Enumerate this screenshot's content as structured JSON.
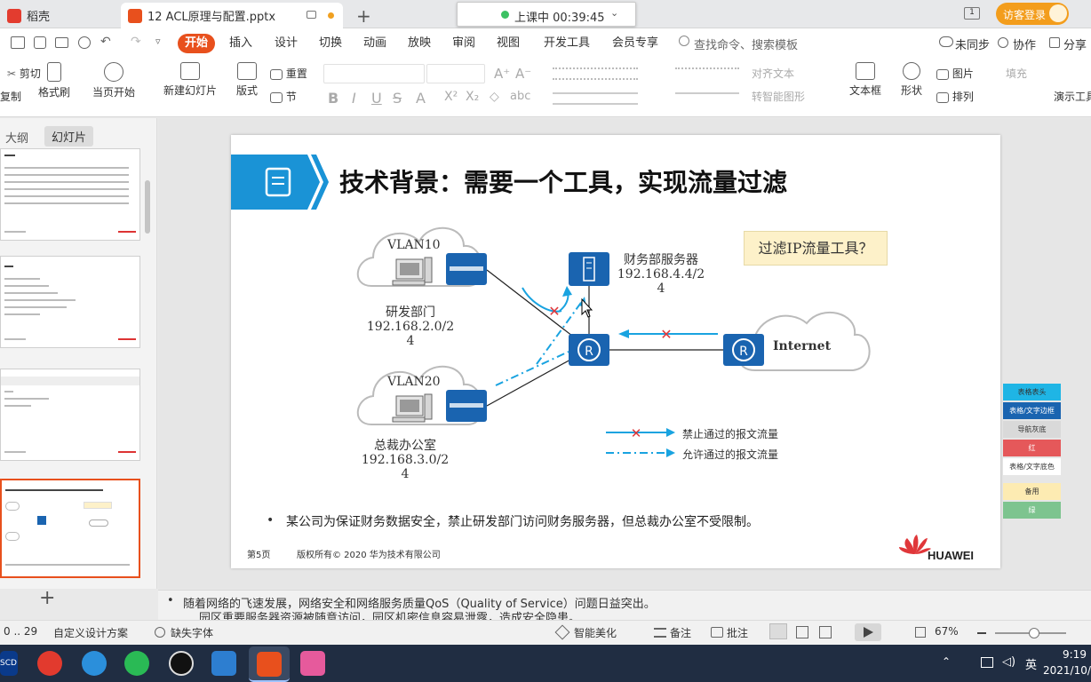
{
  "tabs": {
    "home": "稻壳",
    "file": "12 ACL原理与配置.pptx",
    "new_tab": "+"
  },
  "classroom": {
    "status": "上课中 00:39:45"
  },
  "account": {
    "visitor": "访客登录"
  },
  "ribbon_tabs": [
    "开始",
    "插入",
    "设计",
    "切换",
    "动画",
    "放映",
    "审阅",
    "视图",
    "开发工具",
    "会员专享"
  ],
  "search": {
    "placeholder": "查找命令、搜索模板"
  },
  "top_actions": {
    "sync": "未同步",
    "collab": "协作",
    "share": "分享"
  },
  "toolbar": {
    "cut": "剪切",
    "copy": "复制",
    "format_painter": "格式刷",
    "play_from": "当页开始",
    "new_slide": "新建幻灯片",
    "layout": "版式",
    "reset": "重置",
    "section": "节",
    "text_box": "文本框",
    "shape": "形状",
    "picture": "图片",
    "arrange": "排列",
    "fill": "填充",
    "align_text": "对齐文本",
    "smart_shape": "转智能图形",
    "demo": "演示工具"
  },
  "panel_tabs": {
    "outline": "大纲",
    "slides": "幻灯片"
  },
  "slide": {
    "title": "技术背景：需要一个工具，实现流量过滤",
    "callout": "过滤IP流量工具？",
    "vlan10": "VLAN10",
    "vlan20": "VLAN20",
    "dept_rd": "研发部门",
    "rd_ip": "192.168.2.0/2",
    "rd_ip2": "4",
    "dept_ceo": "总裁办公室",
    "ceo_ip": "192.168.3.0/2",
    "ceo_ip2": "4",
    "server_name": "财务部服务器",
    "server_ip": "192.168.4.4/2",
    "server_ip2": "4",
    "internet": "Internet",
    "legend_deny": "禁止通过的报文流量",
    "legend_allow": "允许通过的报文流量",
    "bullet": "某公司为保证财务数据安全，禁止研发部门访问财务服务器，但总裁办公室不受限制。",
    "page": "第5页",
    "copyright": "版权所有© 2020 华为技术有限公司",
    "brand": "HUAWEI"
  },
  "color_legend": [
    "表格表头",
    "表格/文字边框",
    "导航灰底",
    "红",
    "表格/文字底色",
    "备用",
    "绿"
  ],
  "notes": {
    "line1": "随着网络的飞速发展，网络安全和网络服务质量QoS（Quality of Service）问题日益突出。",
    "line2": "园区重要服务器资源被随意访问，园区机密信息容易泄露，造成安全隐患。"
  },
  "status": {
    "pages": "0 .. 29",
    "design": "自定义设计方案",
    "font": "缺失字体",
    "beautify": "智能美化",
    "notes": "备注",
    "comment": "批注",
    "zoom": "67%"
  },
  "taskbar": {
    "time": "9:19",
    "date": "2021/10/",
    "ime": "英"
  },
  "colors": {
    "accent": "#e8501d",
    "slide_blue": "#1a93d6",
    "device_blue": "#1a64b0",
    "deny_red": "#e0373a",
    "allow_cyan": "#19a3e0"
  }
}
